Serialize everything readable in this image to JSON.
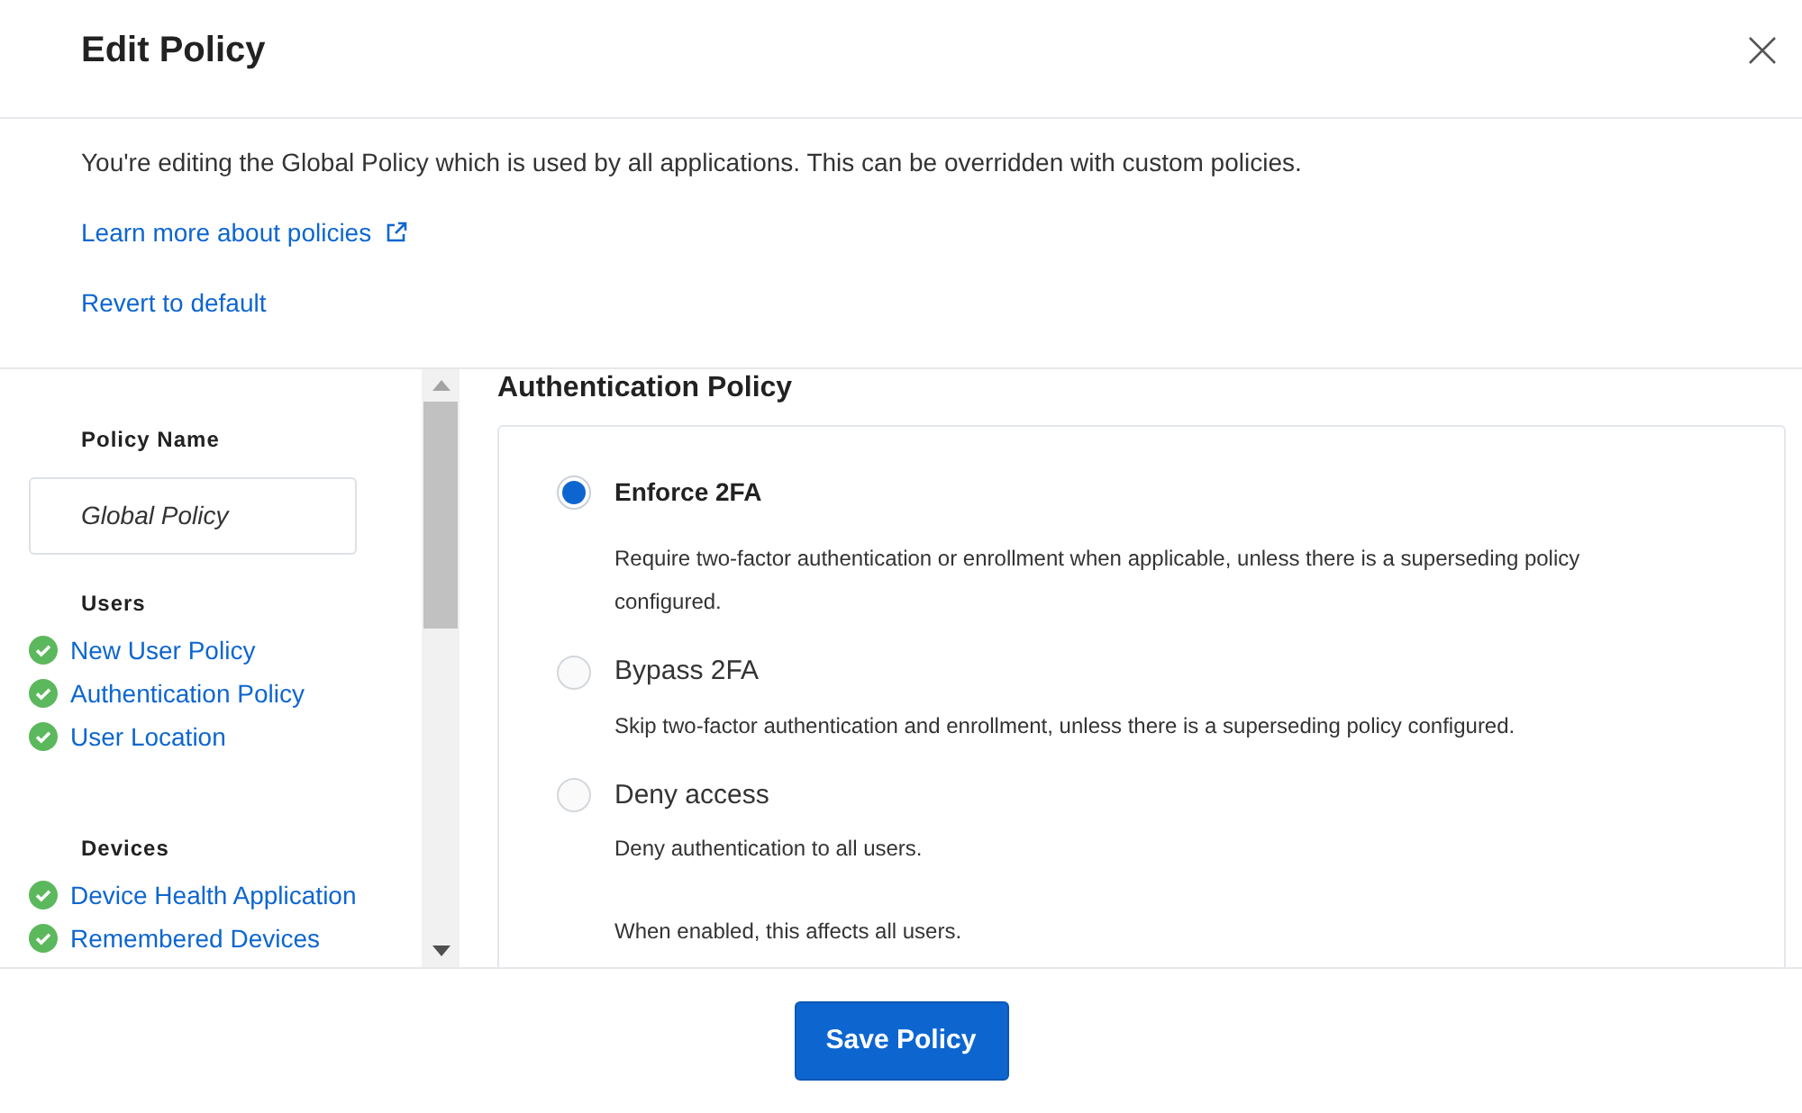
{
  "dialog": {
    "title": "Edit Policy"
  },
  "intro": {
    "text": "You're editing the Global Policy which is used by all applications. This can be overridden with custom policies.",
    "links": [
      {
        "label": "Learn more about policies",
        "external": true
      },
      {
        "label": "Revert to default",
        "external": false
      }
    ]
  },
  "sidebar": {
    "policy_name_label": "Policy Name",
    "policy_name_value": "Global Policy",
    "groups": [
      {
        "title": "Users",
        "items": [
          {
            "label": "New User Policy",
            "complete": true
          },
          {
            "label": "Authentication Policy",
            "complete": true
          },
          {
            "label": "User Location",
            "complete": true
          }
        ]
      },
      {
        "title": "Devices",
        "items": [
          {
            "label": "Device Health Application",
            "complete": true
          },
          {
            "label": "Remembered Devices",
            "complete": true
          }
        ]
      }
    ]
  },
  "section": {
    "title": "Authentication Policy",
    "options": [
      {
        "label": "Enforce 2FA",
        "selected": true,
        "description": [
          "Require two-factor authentication or enrollment when applicable, unless there is a superseding policy configured."
        ]
      },
      {
        "label": "Bypass 2FA",
        "selected": false,
        "description": [
          "Skip two-factor authentication and enrollment, unless there is a superseding policy configured."
        ]
      },
      {
        "label": "Deny access",
        "selected": false,
        "description": [
          "Deny authentication to all users.",
          "When enabled, this affects all users."
        ]
      }
    ]
  },
  "footer": {
    "primary_button": "Save Policy"
  }
}
